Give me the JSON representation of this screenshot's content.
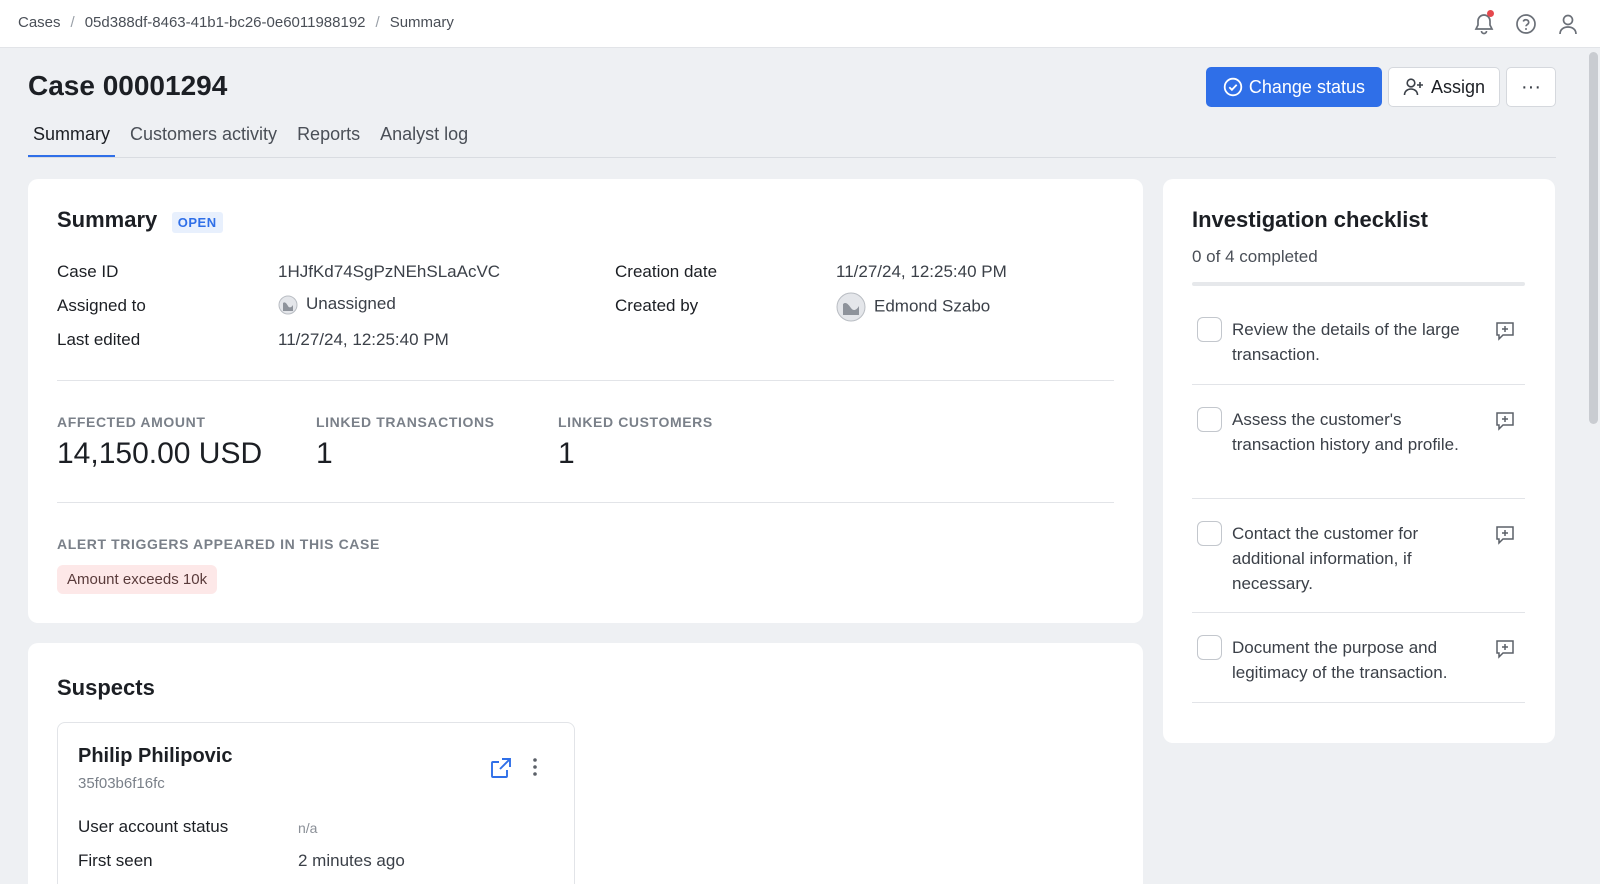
{
  "breadcrumb": {
    "items": [
      "Cases",
      "05d388df-8463-41b1-bc26-0e6011988192",
      "Summary"
    ],
    "separator": "/"
  },
  "header": {
    "title": "Case 00001294",
    "change_status_label": "Change status",
    "assign_label": "Assign",
    "more_label": "···"
  },
  "tabs": [
    {
      "label": "Summary",
      "active": true
    },
    {
      "label": "Customers activity",
      "active": false
    },
    {
      "label": "Reports",
      "active": false
    },
    {
      "label": "Analyst log",
      "active": false
    }
  ],
  "summary": {
    "title": "Summary",
    "status_badge": "OPEN",
    "case_id_label": "Case ID",
    "case_id_value": "1HJfKd74SgPzNEhSLaAcVC",
    "assigned_to_label": "Assigned to",
    "assigned_to_value": "Unassigned",
    "last_edited_label": "Last edited",
    "last_edited_value": "11/27/24, 12:25:40 PM",
    "creation_date_label": "Creation date",
    "creation_date_value": "11/27/24, 12:25:40 PM",
    "created_by_label": "Created by",
    "created_by_value": "Edmond Szabo",
    "stats": [
      {
        "label": "AFFECTED AMOUNT",
        "value": "14,150.00 USD"
      },
      {
        "label": "LINKED TRANSACTIONS",
        "value": "1"
      },
      {
        "label": "LINKED CUSTOMERS",
        "value": "1"
      }
    ],
    "alert_triggers_label": "ALERT TRIGGERS APPEARED IN THIS CASE",
    "alert_triggers": [
      "Amount exceeds 10k"
    ]
  },
  "suspects": {
    "title": "Suspects",
    "items": [
      {
        "name": "Philip Philipovic",
        "id": "35f03b6f16fc",
        "fields": [
          {
            "label": "User account status",
            "value": "n/a"
          },
          {
            "label": "First seen",
            "value": "2 minutes ago"
          }
        ]
      }
    ]
  },
  "checklist": {
    "title": "Investigation checklist",
    "progress_text": "0 of 4 completed",
    "progress_fraction": 0,
    "items": [
      {
        "text": "Review the details of the large transaction.",
        "checked": false
      },
      {
        "text": "Assess the customer's transaction history and profile.",
        "checked": false
      },
      {
        "text": "Contact the customer for additional information, if necessary.",
        "checked": false
      },
      {
        "text": "Document the purpose and legitimacy of the transaction.",
        "checked": false
      }
    ]
  },
  "colors": {
    "accent": "#2f6fe8",
    "notification_dot": "#e5484d",
    "alert_chip_bg": "#fde8e8"
  }
}
